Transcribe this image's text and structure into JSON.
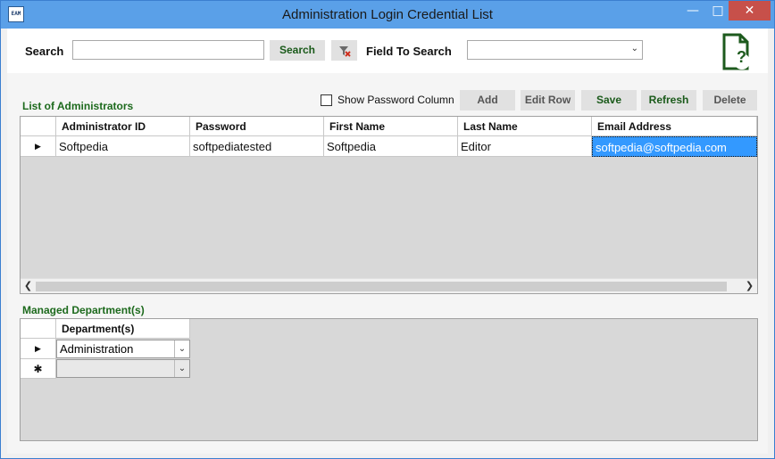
{
  "window": {
    "title": "Administration Login Credential List",
    "icon_text": "EAM",
    "minimize_glyph": "—",
    "maximize_glyph": "□",
    "close_glyph": "✕"
  },
  "toolbar": {
    "search_label": "Search",
    "search_value": "",
    "search_button": "Search",
    "clear_filter_icon": "funnel-x-icon",
    "field_label": "Field To Search",
    "field_value": "",
    "help_icon": "document-help-icon",
    "help_glyph": "?"
  },
  "admins": {
    "section_label": "List of Administrators",
    "show_password_label": "Show Password Column",
    "show_password_checked": false,
    "buttons": {
      "add": "Add",
      "edit": "Edit Row",
      "save": "Save",
      "refresh": "Refresh",
      "delete": "Delete"
    },
    "columns": [
      "Administrator ID",
      "Password",
      "First Name",
      "Last Name",
      "Email Address"
    ],
    "rows": [
      {
        "row_marker": "▶",
        "cells": [
          "Softpedia",
          "softpediatested",
          "Softpedia",
          "Editor",
          "softpedia@softpedia.com"
        ]
      }
    ],
    "scroll_left": "❮",
    "scroll_right": "❯"
  },
  "departments": {
    "section_label": "Managed Department(s)",
    "column": "Department(s)",
    "rows": [
      {
        "row_marker": "▶",
        "value": "Administration"
      },
      {
        "row_marker": "✱",
        "value": ""
      }
    ],
    "dropdown_glyph": "⌄"
  },
  "colors": {
    "accent_green": "#1d6a1d",
    "selection_blue": "#3399ff",
    "titlebar": "#5aa0e8",
    "close_red": "#c7504a"
  }
}
